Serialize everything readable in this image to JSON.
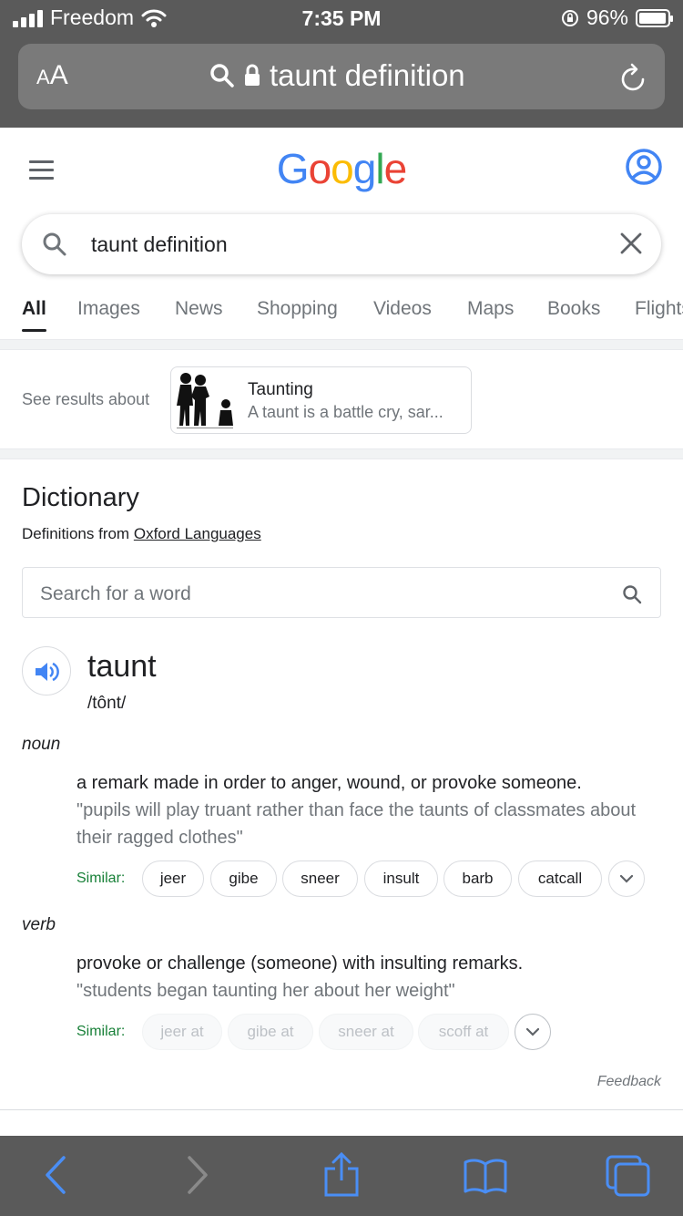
{
  "status": {
    "carrier": "Freedom",
    "time": "7:35 PM",
    "battery": "96%",
    "battery_level": 0.96
  },
  "safari": {
    "text_size_label": "AA",
    "url_text": "taunt definition"
  },
  "google": {
    "logo": "Google",
    "query": "taunt definition"
  },
  "tabs": [
    "All",
    "Images",
    "News",
    "Shopping",
    "Videos",
    "Maps",
    "Books",
    "Flights"
  ],
  "see_results": {
    "label": "See results about",
    "card_title": "Taunting",
    "card_snippet": "A taunt is a battle cry, sar..."
  },
  "dictionary": {
    "title": "Dictionary",
    "source_prefix": "Definitions from",
    "source_link": "Oxford Languages",
    "search_placeholder": "Search for a word",
    "word": "taunt",
    "phonetic": "/tônt/",
    "senses": [
      {
        "pos": "noun",
        "definition": "a remark made in order to anger, wound, or provoke someone.",
        "example": "\"pupils will play truant rather than face the taunts of classmates about their ragged clothes\"",
        "similar_label": "Similar:",
        "similar": [
          "jeer",
          "gibe",
          "sneer",
          "insult",
          "barb",
          "catcall"
        ]
      },
      {
        "pos": "verb",
        "definition": "provoke or challenge (someone) with insulting remarks.",
        "example": "\"students began taunting her about her weight\"",
        "similar_label": "Similar:",
        "similar": [
          "jeer at",
          "gibe at",
          "sneer at",
          "scoff at"
        ]
      }
    ],
    "feedback": "Feedback"
  },
  "colors": {
    "google_blue": "#4285F4",
    "google_red": "#EA4335",
    "google_yellow": "#FBBC05",
    "google_green": "#34A853",
    "similar_green": "#188038",
    "ios_blue": "#4a8ef5"
  }
}
